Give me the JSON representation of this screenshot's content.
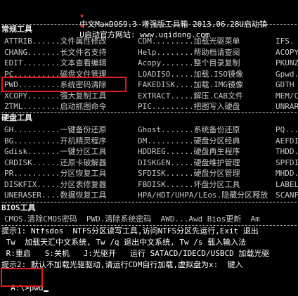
{
  "header": {
    "star": "★",
    "title": "中文MaxDOS9.3 增强版工具箱 2013.06.28U启动镇",
    "site": "U启动官方网站: www.uqidong.com"
  },
  "sections": {
    "common": "常规工具",
    "disk": "硬盘工具",
    "bios": "BIOS工具"
  },
  "common_rows": [
    [
      "ATTRIB......文件属性修改",
      "CDM.........加载光驱菜单",
      "IFS."
    ],
    [
      "CHANG.......长文件名支持",
      "Help........帮助档请查阅",
      "ACOPY"
    ],
    [
      "EDIT........文本查看编辑",
      "Acopy.......整个目录复制",
      "PKUNZ"
    ],
    [
      "PC..........磁盘文件管理",
      "LOADISO.....加载.ISO镜像",
      "Gpwd."
    ],
    [
      "PWD.........系统密码清除",
      "FAKEDISK....加载.IMG镜像",
      "GDTH"
    ],
    [
      "XCOPY.......强大复制工具",
      "EXTRACT.....解压.CAB文件",
      "MEM/C"
    ],
    [
      "ZTML........启动抓图命令",
      "PIC.........把图写入硬盘",
      "UNRAR"
    ]
  ],
  "disk_rows": [
    [
      "GH..........一键备份还原",
      "Ghost.......系统备份还原",
      "PQ..."
    ],
    [
      "BG..........开机精灵程序",
      "DM..........硬盘分区经典",
      "AEFDI"
    ],
    [
      "Gdisk.......一键分区工具",
      "HDDREG......硬盘再生程序",
      "THDD."
    ],
    [
      "CRDISK......还原卡破解器",
      "DISKGEN.....硬盘维护管理",
      "SPFDI"
    ],
    [
      "PR..........分区恢复工具",
      "SFDISK......硬盘分区管理",
      "MHDD."
    ],
    [
      "DISKFIX.....分区表修复器",
      "FBDISK......坏盘分区工具",
      "LABEL"
    ],
    [
      "UNERASER....数据恢复工具",
      "HPA/HDT/UHPA/LEos.隐藏分区释放",
      "SCANF"
    ]
  ],
  "bios_line": "CMOS.清除CMOS密码  PWD.清除系统密码  AWD...Awd Bios更新  Am",
  "hints": [
    "提示1: Ntfsdos  NTFS分区读写工具,访问NTFS分区先运行,Exit 退出",
    " Tw  加载天汇中文系统, Tw /q 退出中文系统, Tw /s 载入输入法",
    " R:重启   S:关机   J:光驱开   运行 SATACD/IDECD/USBCD 加载光驱",
    "提示2: 默认不加载光驱驱动,请运行CDM自行加载,虚拟盘为x:  键入"
  ],
  "prompt": {
    "path": "A:\\>",
    "command": "pwd"
  },
  "colors": {
    "background": "#000000",
    "text": "#c8c8c8",
    "header_star": "#ff2a2a",
    "highlight_box": "#e21b1b"
  }
}
